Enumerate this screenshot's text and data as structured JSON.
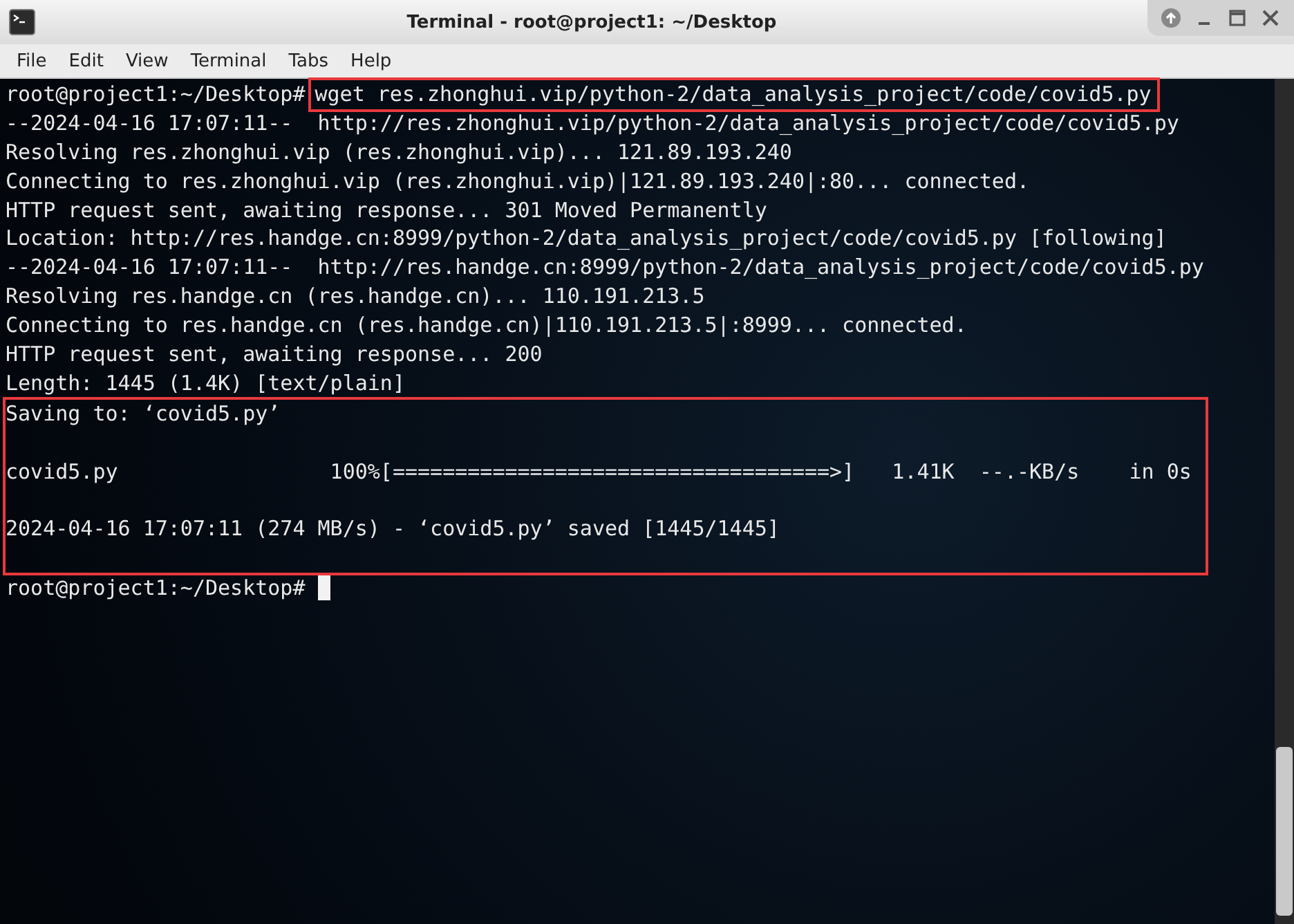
{
  "window": {
    "title": "Terminal - root@project1: ~/Desktop"
  },
  "menu": [
    "File",
    "Edit",
    "View",
    "Terminal",
    "Tabs",
    "Help"
  ],
  "terminal": {
    "sections": [
      {
        "highlighted": false,
        "lines": [
          {
            "kind": "command",
            "prompt": "root@project1:~/Desktop#",
            "command": "wget res.zhonghui.vip/python-2/data_analysis_project/code/covid5.py",
            "highlighted": true
          },
          {
            "kind": "output",
            "text": "--2024-04-16 17:07:11--  http://res.zhonghui.vip/python-2/data_analysis_project/code/covid5.py"
          },
          {
            "kind": "output",
            "text": "Resolving res.zhonghui.vip (res.zhonghui.vip)... 121.89.193.240"
          },
          {
            "kind": "output",
            "text": "Connecting to res.zhonghui.vip (res.zhonghui.vip)|121.89.193.240|:80... connected."
          },
          {
            "kind": "output",
            "text": "HTTP request sent, awaiting response... 301 Moved Permanently"
          },
          {
            "kind": "output",
            "text": "Location: http://res.handge.cn:8999/python-2/data_analysis_project/code/covid5.py [following]"
          },
          {
            "kind": "output",
            "text": "--2024-04-16 17:07:11--  http://res.handge.cn:8999/python-2/data_analysis_project/code/covid5.py"
          },
          {
            "kind": "output",
            "text": "Resolving res.handge.cn (res.handge.cn)... 110.191.213.5"
          },
          {
            "kind": "output",
            "text": "Connecting to res.handge.cn (res.handge.cn)|110.191.213.5|:8999... connected."
          },
          {
            "kind": "output",
            "text": "HTTP request sent, awaiting response... 200"
          },
          {
            "kind": "output",
            "text": "Length: 1445 (1.4K) [text/plain]"
          }
        ]
      },
      {
        "highlighted": true,
        "lines": [
          {
            "kind": "output",
            "text": "Saving to: ‘covid5.py’"
          },
          {
            "kind": "blank"
          },
          {
            "kind": "output",
            "text": "covid5.py                 100%[===================================>]   1.41K  --.-KB/s    in 0s"
          },
          {
            "kind": "blank"
          },
          {
            "kind": "output",
            "text": "2024-04-16 17:07:11 (274 MB/s) - ‘covid5.py’ saved [1445/1445]"
          },
          {
            "kind": "blank"
          }
        ]
      },
      {
        "highlighted": false,
        "lines": [
          {
            "kind": "prompt",
            "prompt": "root@project1:~/Desktop#"
          }
        ]
      }
    ]
  }
}
